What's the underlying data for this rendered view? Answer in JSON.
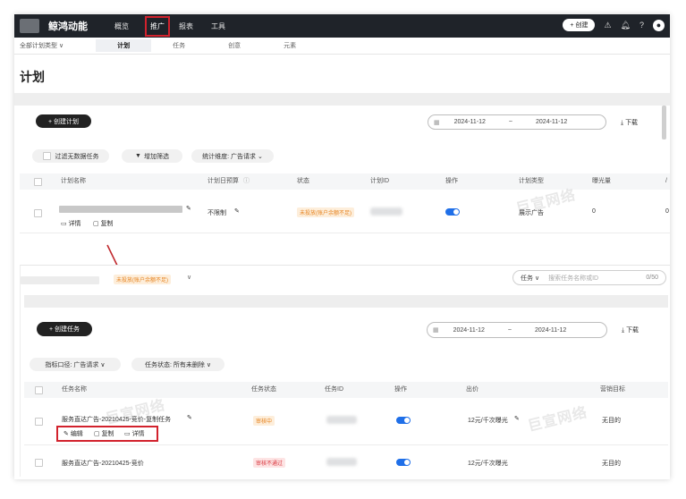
{
  "topnav": {
    "brand": "鲸鸿动能",
    "items": [
      "概览",
      "推广",
      "报表",
      "工具"
    ],
    "active": "推广",
    "create_label": "+ 创建"
  },
  "subnav": {
    "plan_type": "全部计划类型 ∨",
    "tabs": [
      "计划",
      "任务",
      "创意",
      "元素"
    ],
    "active": "计划"
  },
  "page": {
    "title": "计划",
    "create_plan": "+ 创建计划",
    "date_start": "2024-11-12",
    "date_sep": "~",
    "date_end": "2024-11-12",
    "download": "下载",
    "filters": {
      "no_data": "过滤无数据任务",
      "add_filter": "增加筛选",
      "stat_dim": "统计维度: 广告请求"
    }
  },
  "plan_table": {
    "headers": [
      "计划名称",
      "计划日预算",
      "状态",
      "计划ID",
      "操作",
      "计划类型",
      "曝光量",
      "/"
    ],
    "row": {
      "budget": "不限制",
      "status": "未投放(账户余额不足)",
      "type": "展示广告",
      "impressions": "0",
      "trailing": "0",
      "action_detail": "详情",
      "action_copy": "复制"
    }
  },
  "detail": {
    "status_tag": "未投放(账户余额不足)",
    "caret": "∨",
    "search_scope": "任务 ∨",
    "search_placeholder": "搜索任务名称或ID",
    "search_count": "0/50",
    "create_task": "+ 创建任务",
    "date_start": "2024-11-12",
    "date_sep": "~",
    "date_end": "2024-11-12",
    "download": "下载",
    "chip_stat": "指标口径: 广告请求 ∨",
    "chip_status": "任务状态: 所有未删除 ∨",
    "headers": [
      "任务名称",
      "任务状态",
      "任务ID",
      "操作",
      "出价",
      "营销目标"
    ],
    "rows": [
      {
        "name": "服务直达广告-20210425-竞价-复制任务",
        "status": "审核中",
        "bid": "12元/千次曝光",
        "goal": "无目的",
        "actions": [
          "编辑",
          "复制",
          "详情"
        ]
      },
      {
        "name": "服务直达广告-20210425-竞价",
        "status": "审核不通过",
        "bid": "12元/千次曝光",
        "goal": "无目的"
      }
    ]
  },
  "watermark": "巨宣网络",
  "colors": {
    "nav_bg": "#1f2329",
    "highlight_red": "#d2222d",
    "link_blue": "#1f6fe8",
    "warn_orange": "#e6831f",
    "error_red": "#d9363e"
  }
}
